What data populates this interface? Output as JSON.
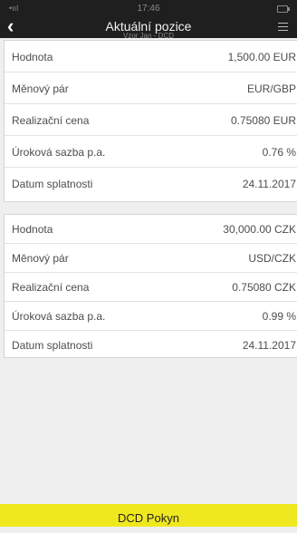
{
  "status": {
    "time": "17:46",
    "signal": "•ııl"
  },
  "header": {
    "title": "Aktuální pozice",
    "subtitle": "Vzor Jan - DCD"
  },
  "positions": [
    {
      "rows": [
        {
          "label": "Hodnota",
          "value": "1,500.00 EUR"
        },
        {
          "label": "Měnový pár",
          "value": "EUR/GBP"
        },
        {
          "label": "Realizační cena",
          "value": "0.75080 EUR"
        },
        {
          "label": "Úroková sazba p.a.",
          "value": "0.76 %"
        },
        {
          "label": "Datum splatnosti",
          "value": "24.11.2017"
        }
      ]
    },
    {
      "rows": [
        {
          "label": "Hodnota",
          "value": "30,000.00 CZK"
        },
        {
          "label": "Měnový pár",
          "value": "USD/CZK"
        },
        {
          "label": "Realizační cena",
          "value": "0.75080 CZK"
        },
        {
          "label": "Úroková sazba p.a.",
          "value": "0.99 %"
        },
        {
          "label": "Datum splatnosti",
          "value": "24.11.2017"
        }
      ]
    }
  ],
  "footer": {
    "button_label": "DCD Pokyn"
  },
  "colors": {
    "header_bg": "#1f1f1f",
    "accent": "#f0e81f"
  }
}
